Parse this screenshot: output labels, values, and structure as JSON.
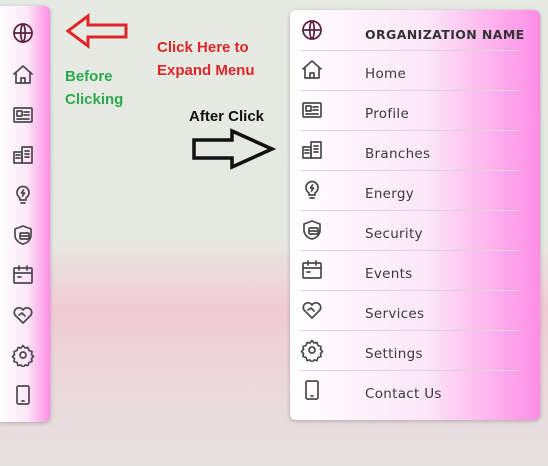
{
  "annotations": {
    "click_here": "Click Here to Expand Menu",
    "click_here_line1": "Click Here to",
    "click_here_line2": "Expand Menu",
    "before_line1": "Before",
    "before_line2": "Clicking",
    "after": "After Click"
  },
  "colors": {
    "sidebar_gradient_end": "#ff8de6",
    "annotation_red": "#e0252a",
    "annotation_green": "#2ea84f",
    "globe_icon": "#5a1f3c"
  },
  "sidebar": {
    "title": "ORGANIZATION NAME",
    "title_icon": "globe-icon",
    "items": [
      {
        "label": "Home",
        "icon": "home-icon"
      },
      {
        "label": "Profile",
        "icon": "profile-card-icon"
      },
      {
        "label": "Branches",
        "icon": "buildings-icon"
      },
      {
        "label": "Energy",
        "icon": "lightbulb-icon"
      },
      {
        "label": "Security",
        "icon": "shield-icon"
      },
      {
        "label": "Events",
        "icon": "calendar-icon"
      },
      {
        "label": "Services",
        "icon": "heart-icon"
      },
      {
        "label": "Settings",
        "icon": "gear-icon"
      },
      {
        "label": "Contact Us",
        "icon": "phone-icon"
      }
    ]
  }
}
